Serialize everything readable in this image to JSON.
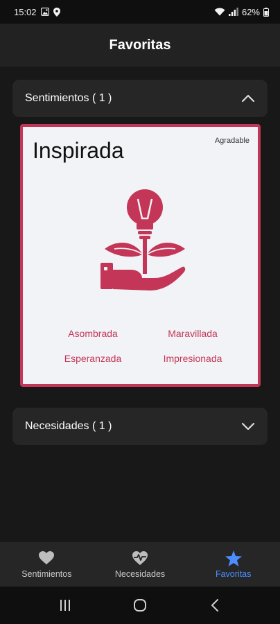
{
  "status_bar": {
    "time": "15:02",
    "battery": "62%"
  },
  "app_bar": {
    "title": "Favoritas"
  },
  "sections": [
    {
      "label": "Sentimientos ( 1 )",
      "expanded": true
    },
    {
      "label": "Necesidades ( 1 )",
      "expanded": false
    }
  ],
  "feeling_card": {
    "title": "Inspirada",
    "tag": "Agradable",
    "accent_color": "#c43657",
    "icon": "lightbulb-plant-hand-icon",
    "related": [
      "Asombrada",
      "Maravillada",
      "Esperanzada",
      "Impresionada"
    ]
  },
  "bottom_nav": {
    "active_color": "#4c8dff",
    "items": [
      {
        "label": "Sentimientos",
        "icon": "heart-icon",
        "active": false
      },
      {
        "label": "Necesidades",
        "icon": "heartbeat-icon",
        "active": false
      },
      {
        "label": "Favoritas",
        "icon": "star-icon",
        "active": true
      }
    ]
  }
}
